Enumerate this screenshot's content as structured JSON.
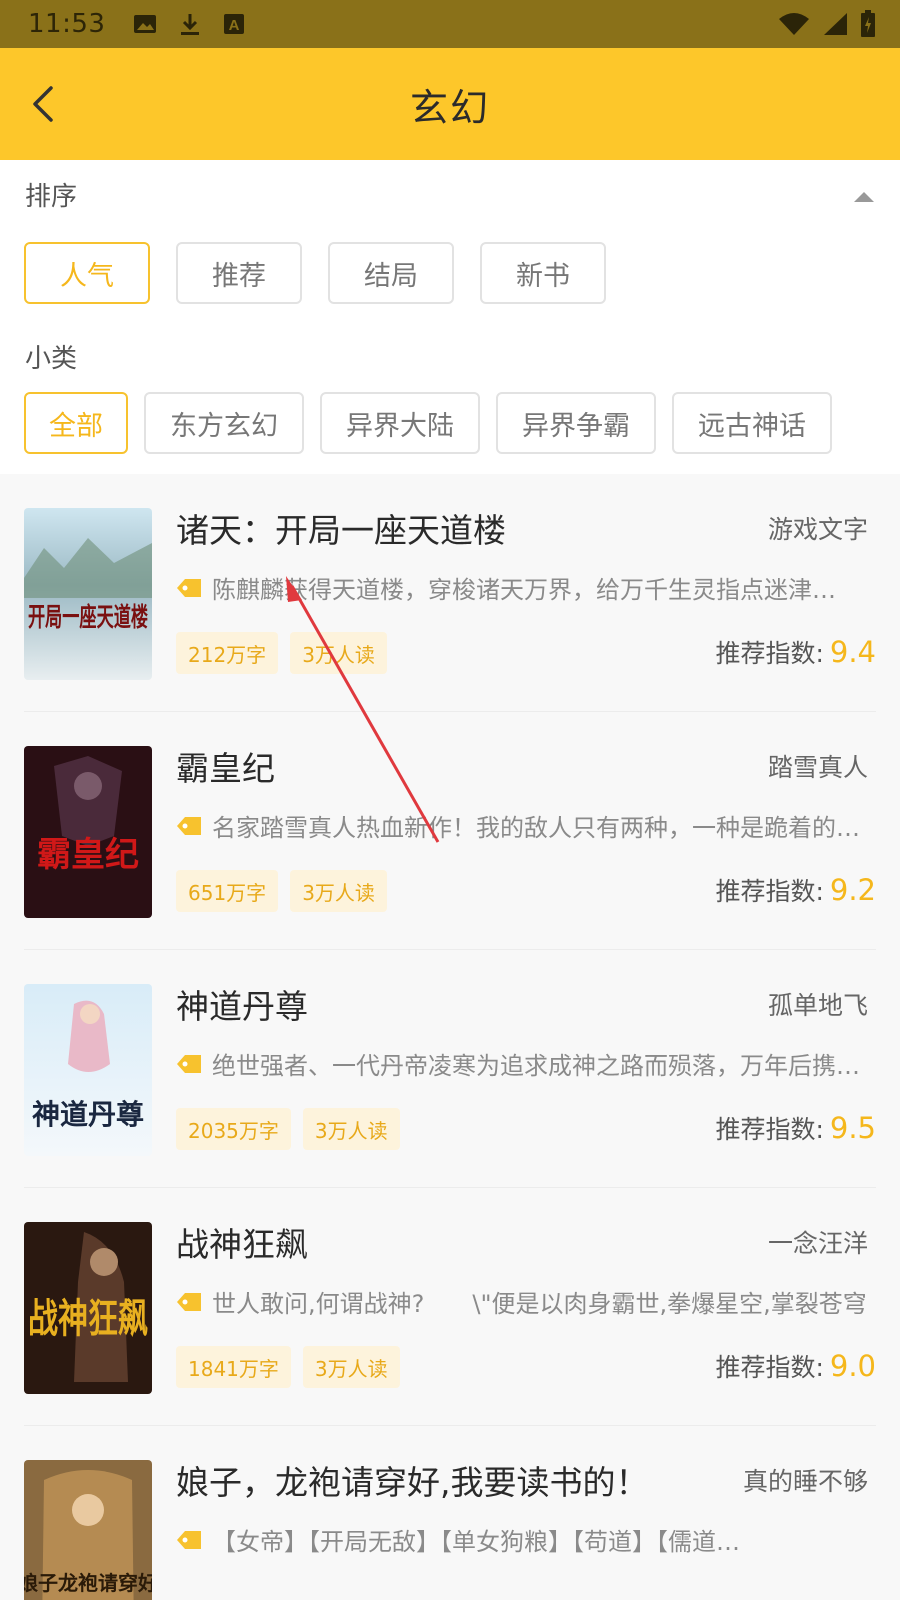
{
  "status_bar": {
    "time": "11:53",
    "icons": [
      "image-icon",
      "download-icon",
      "font-a-icon",
      "wifi-icon",
      "signal-icon",
      "battery-icon"
    ]
  },
  "header": {
    "title": "玄幻"
  },
  "sort": {
    "label": "排序",
    "options": [
      "人气",
      "推荐",
      "结局",
      "新书"
    ],
    "selected": "人气"
  },
  "subcategory": {
    "label": "小类",
    "options": [
      "全部",
      "东方玄幻",
      "异界大陆",
      "异界争霸",
      "远古神话"
    ],
    "selected": "全部"
  },
  "score_label": "推荐指数:",
  "books": [
    {
      "title": "诸天：开局一座天道楼",
      "author": "游戏文字",
      "desc": "陈麒麟获得天道楼，穿梭诸天万界，给万千生灵指点迷津…",
      "words": "212万字",
      "readers": "3万人读",
      "score": "9.4",
      "cover_text": "开局一座天道楼"
    },
    {
      "title": "霸皇纪",
      "author": "踏雪真人",
      "desc": "名家踏雪真人热血新作！我的敌人只有两种，一种是跪着的，…",
      "words": "651万字",
      "readers": "3万人读",
      "score": "9.2",
      "cover_text": "霸皇纪"
    },
    {
      "title": "神道丹尊",
      "author": "孤单地飞",
      "desc": "绝世强者、一代丹帝凌寒为追求成神之路而殒落，万年后携《…",
      "words": "2035万字",
      "readers": "3万人读",
      "score": "9.5",
      "cover_text": "神道丹尊"
    },
    {
      "title": "战神狂飙",
      "author": "一念汪洋",
      "desc": "世人敢问,何谓战神?　　\\\"便是以肉身霸世,拳爆星空,掌裂苍穹",
      "words": "1841万字",
      "readers": "3万人读",
      "score": "9.0",
      "cover_text": "战神狂飙"
    },
    {
      "title": "娘子，龙袍请穿好,我要读书的！",
      "author": "真的睡不够",
      "desc": "【女帝】【开局无敌】【单女狗粮】【苟道】【儒道…",
      "words": "",
      "readers": "",
      "score": "",
      "cover_text": "娘子龙袍请穿好"
    }
  ],
  "colors": {
    "status_bar": "#8a7119",
    "app_bar": "#fdc72a",
    "accent": "#f5b71c",
    "badge_bg": "#fdf3dc"
  }
}
